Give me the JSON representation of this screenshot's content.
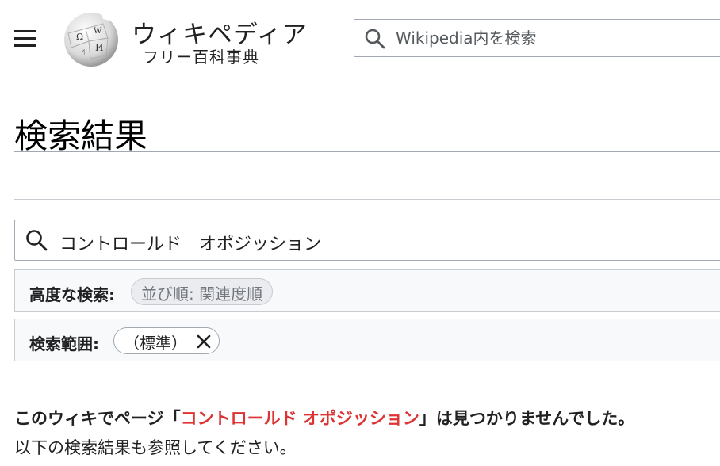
{
  "header": {
    "wordmark": "ウィキペディア",
    "tagline": "フリー百科事典",
    "search_placeholder": "Wikipedia内を検索"
  },
  "page": {
    "title": "検索結果"
  },
  "query": {
    "value": "コントロールド　オポジッション"
  },
  "advanced": {
    "label": "高度な検索:",
    "sort_chip": "並び順: 関連度順"
  },
  "namespace": {
    "label": "検索範囲:",
    "chip": "（標準）"
  },
  "results": {
    "notice_prefix": "このウィキでページ「",
    "notice_link": "コントロールド オポジッション",
    "notice_suffix": "」は見つかりませんでした。",
    "subline": "以下の検索結果も参照してください。"
  },
  "colors": {
    "link_red": "#d33",
    "panel_bg": "#f8f9fa",
    "border": "#a2a9b1"
  },
  "icons": [
    "menu-icon",
    "wikipedia-globe-logo",
    "search-icon",
    "close-icon"
  ]
}
